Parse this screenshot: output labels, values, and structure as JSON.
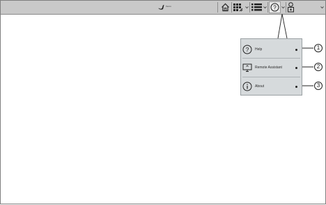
{
  "app": {
    "name": "Xerox"
  },
  "toolbar": {
    "home_icon": "home-icon",
    "apps_icon": "apps-grid-icon",
    "list_icon": "list-icon",
    "help_icon": "help-icon",
    "user_icon": "user-lock-icon"
  },
  "help_menu": {
    "items": [
      {
        "label": "Help",
        "icon": "question-circle-icon",
        "callout": "1"
      },
      {
        "label": "Remote Assistant",
        "icon": "monitor-icon",
        "callout": "2"
      },
      {
        "label": "About",
        "icon": "info-circle-icon",
        "callout": "3"
      }
    ]
  },
  "colors": {
    "toolbar": "#c9c9c9",
    "menu_bg": "#d6dadc",
    "border": "#7f7f7f"
  }
}
